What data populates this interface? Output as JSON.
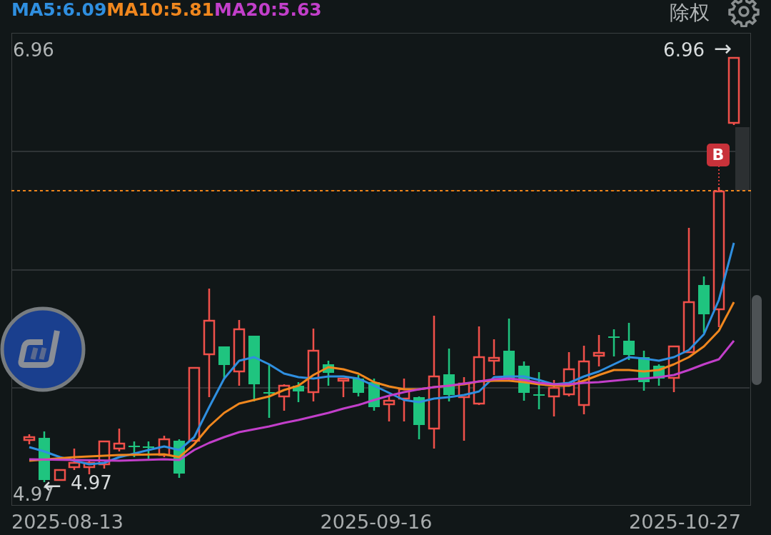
{
  "indicators": [
    {
      "label": "MA5:6.09",
      "color": "#2f8fe0"
    },
    {
      "label": "MA10:5.81",
      "color": "#f0871e"
    },
    {
      "label": "MA20:5.63",
      "color": "#c23fca"
    }
  ],
  "adjust_button": "除权",
  "y_axis": {
    "max": "6.96",
    "min": "4.97"
  },
  "high_marker": {
    "value": "6.96",
    "arrow": "→"
  },
  "low_marker": {
    "value": "4.97",
    "arrow": "←"
  },
  "trade_marker": "B",
  "x_axis": [
    "2025-08-13",
    "2025-09-16",
    "2025-10-27"
  ]
}
